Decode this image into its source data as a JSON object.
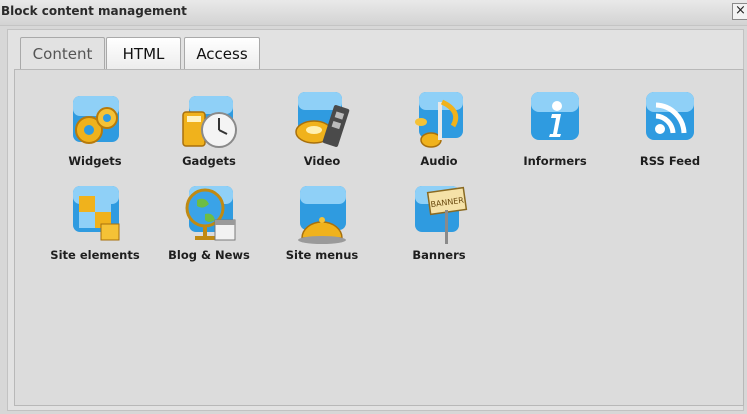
{
  "window": {
    "title": "Block content management",
    "close_glyph": "×"
  },
  "tabs": [
    {
      "label": "Content",
      "active": true
    },
    {
      "label": "HTML",
      "active": false
    },
    {
      "label": "Access",
      "active": false
    }
  ],
  "items": [
    {
      "label": "Widgets",
      "icon": "gears-icon"
    },
    {
      "label": "Gadgets",
      "icon": "calculator-clock-icon"
    },
    {
      "label": "Video",
      "icon": "film-reel-icon"
    },
    {
      "label": "Audio",
      "icon": "music-note-icon"
    },
    {
      "label": "Informers",
      "icon": "info-icon"
    },
    {
      "label": "RSS Feed",
      "icon": "rss-icon"
    },
    {
      "label": "Site elements",
      "icon": "puzzle-icon"
    },
    {
      "label": "Blog & News",
      "icon": "globe-calendar-icon"
    },
    {
      "label": "Site menus",
      "icon": "cloche-icon"
    },
    {
      "label": "Banners",
      "icon": "banner-sign-icon",
      "icon_text": "BANNER"
    }
  ],
  "colors": {
    "tile_blue": "#2f9be0",
    "tile_light": "#8fd0f7",
    "gold": "#f0b21c"
  }
}
